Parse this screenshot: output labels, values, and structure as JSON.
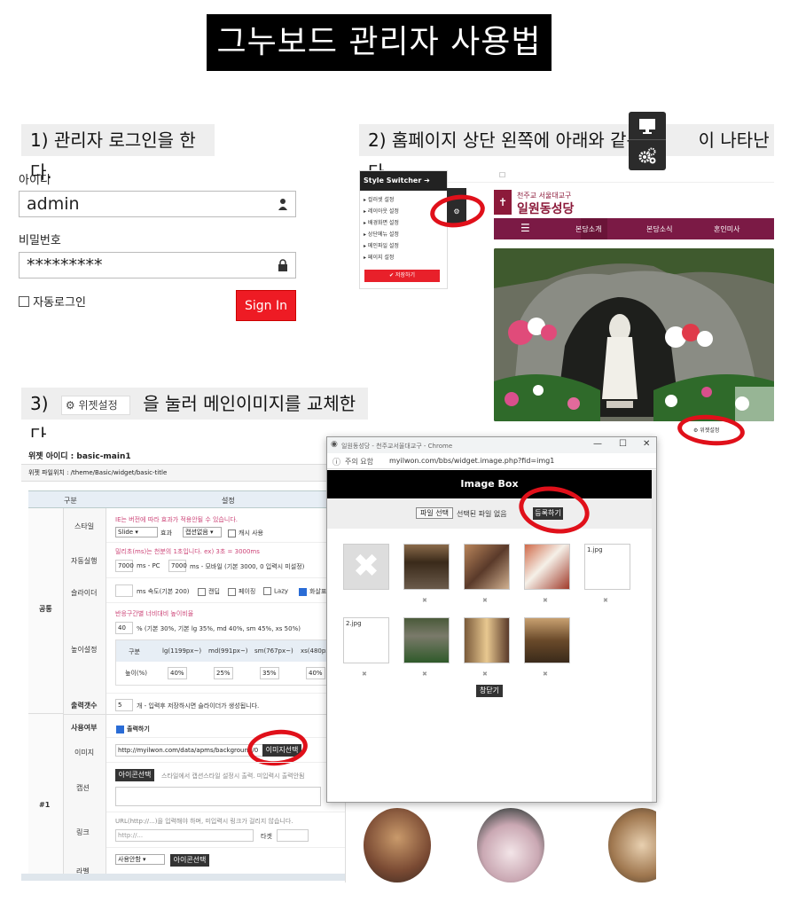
{
  "title": "그누보드 관리자 사용법",
  "steps": {
    "s1": "1) 관리자 로그인을 한다.",
    "s2a": "2) 홈페이지 상단 왼쪽에 아래와 같은",
    "s2b": "이 나타난다.",
    "s3a": "3)",
    "s3btn": "위젯설정",
    "s3b": "을 눌러 메인이미지를 교체한다."
  },
  "login": {
    "id_label": "아이디",
    "id_value": "admin",
    "pw_label": "비밀번호",
    "pw_value": "*********",
    "auto_label": "자동로그인",
    "signin": "Sign In"
  },
  "switcher": {
    "header": "Style Switcher",
    "items": [
      "컬러셋 설정",
      "레이아웃 설정",
      "배경화면 설정",
      "상단메뉴 설정",
      "메인파일 설정",
      "페이지 설정"
    ],
    "save": "저장하기"
  },
  "site": {
    "logo_sub": "천주교 서울대교구",
    "logo_main": "일원동성당",
    "menu": [
      "본당소개",
      "본당소식",
      "혼인미사"
    ],
    "widget_link": "위젯설정"
  },
  "widget": {
    "id_label": "위젯 아이디 : basic-main1",
    "path_label": "위젯 파일위치 : /theme/Basic/widget/basic-title",
    "col_div": "구분",
    "col_set": "설정",
    "group_common": "공통",
    "group_1": "#1",
    "style_label": "스타일",
    "style_note": "IE는 버전에 따라 효과가 적용안될 수 있습니다.",
    "style_sel": "Slide",
    "effect_label": "효과",
    "effect_sel": "캡션없음",
    "cache_label": "캐시 사용",
    "auto_label": "자동실행",
    "auto_note": "밀리초(ms)는 천분의 1초입니다. ex) 3초 = 3000ms",
    "auto_pc": "7000",
    "auto_pc_unit": "ms - PC",
    "auto_mo": "7000",
    "auto_mo_unit": "ms - 모바일 (기본 3000, 0 입력시 미설정)",
    "slider_label": "슬라이더",
    "slider_unit": "ms 속도(기본 200)",
    "opt_thumb": "캔딥",
    "opt_page": "페이징",
    "opt_lazy": "Lazy",
    "opt_arrow": "화살표",
    "height_label": "높이설정",
    "height_note": "반응구간별 너비대비 높이비율",
    "height_val": "40",
    "height_unit": "% (기본 30%, 기본 lg 35%, md 40%, sm 45%, xs 50%)",
    "bp_headers": [
      "구분",
      "lg(1199px~)",
      "md(991px~)",
      "sm(767px~)",
      "xs(480px~)"
    ],
    "bp_row_label": "높이(%)",
    "bp_values": [
      "40%",
      "25%",
      "35%",
      "40%"
    ],
    "count_label": "출력갯수",
    "count_val": "5",
    "count_unit": "개 - 입력후 저장하시면 슬라이더가 생성됩니다.",
    "use_label": "사용여부",
    "use_opt": "출력하기",
    "image_label": "이미지",
    "image_val": "http://myilwon.com/data/apms/background/0",
    "image_btn": "이미지선택",
    "caption_label": "캡션",
    "icon_btn": "아이콘선택",
    "caption_note": "스타일에서 캡션스타일 설정시 출력. 미입력시 출력안됨",
    "link_label": "링크",
    "link_note": "URL(http://...)을 입력해야 하며, 미입력시 링크가 걸리지 않습니다.",
    "link_ph": "http://...",
    "target_label": "타겟",
    "label_label": "라벨",
    "label_sel": "사용안함",
    "label_btn": "아이콘선택"
  },
  "popup": {
    "window_title": "일원동성당 - 천주교서울대교구 - Chrome",
    "addr_warn": "주의 요함",
    "addr_url": "myilwon.com/bbs/widget.image.php?fid=img1",
    "header": "Image Box",
    "file_btn": "파일 선택",
    "file_none": "선택된 파일 없음",
    "register": "등록하기",
    "broken1": "1.jpg",
    "broken2": "2.jpg",
    "close": "창닫기",
    "del": "✖"
  }
}
